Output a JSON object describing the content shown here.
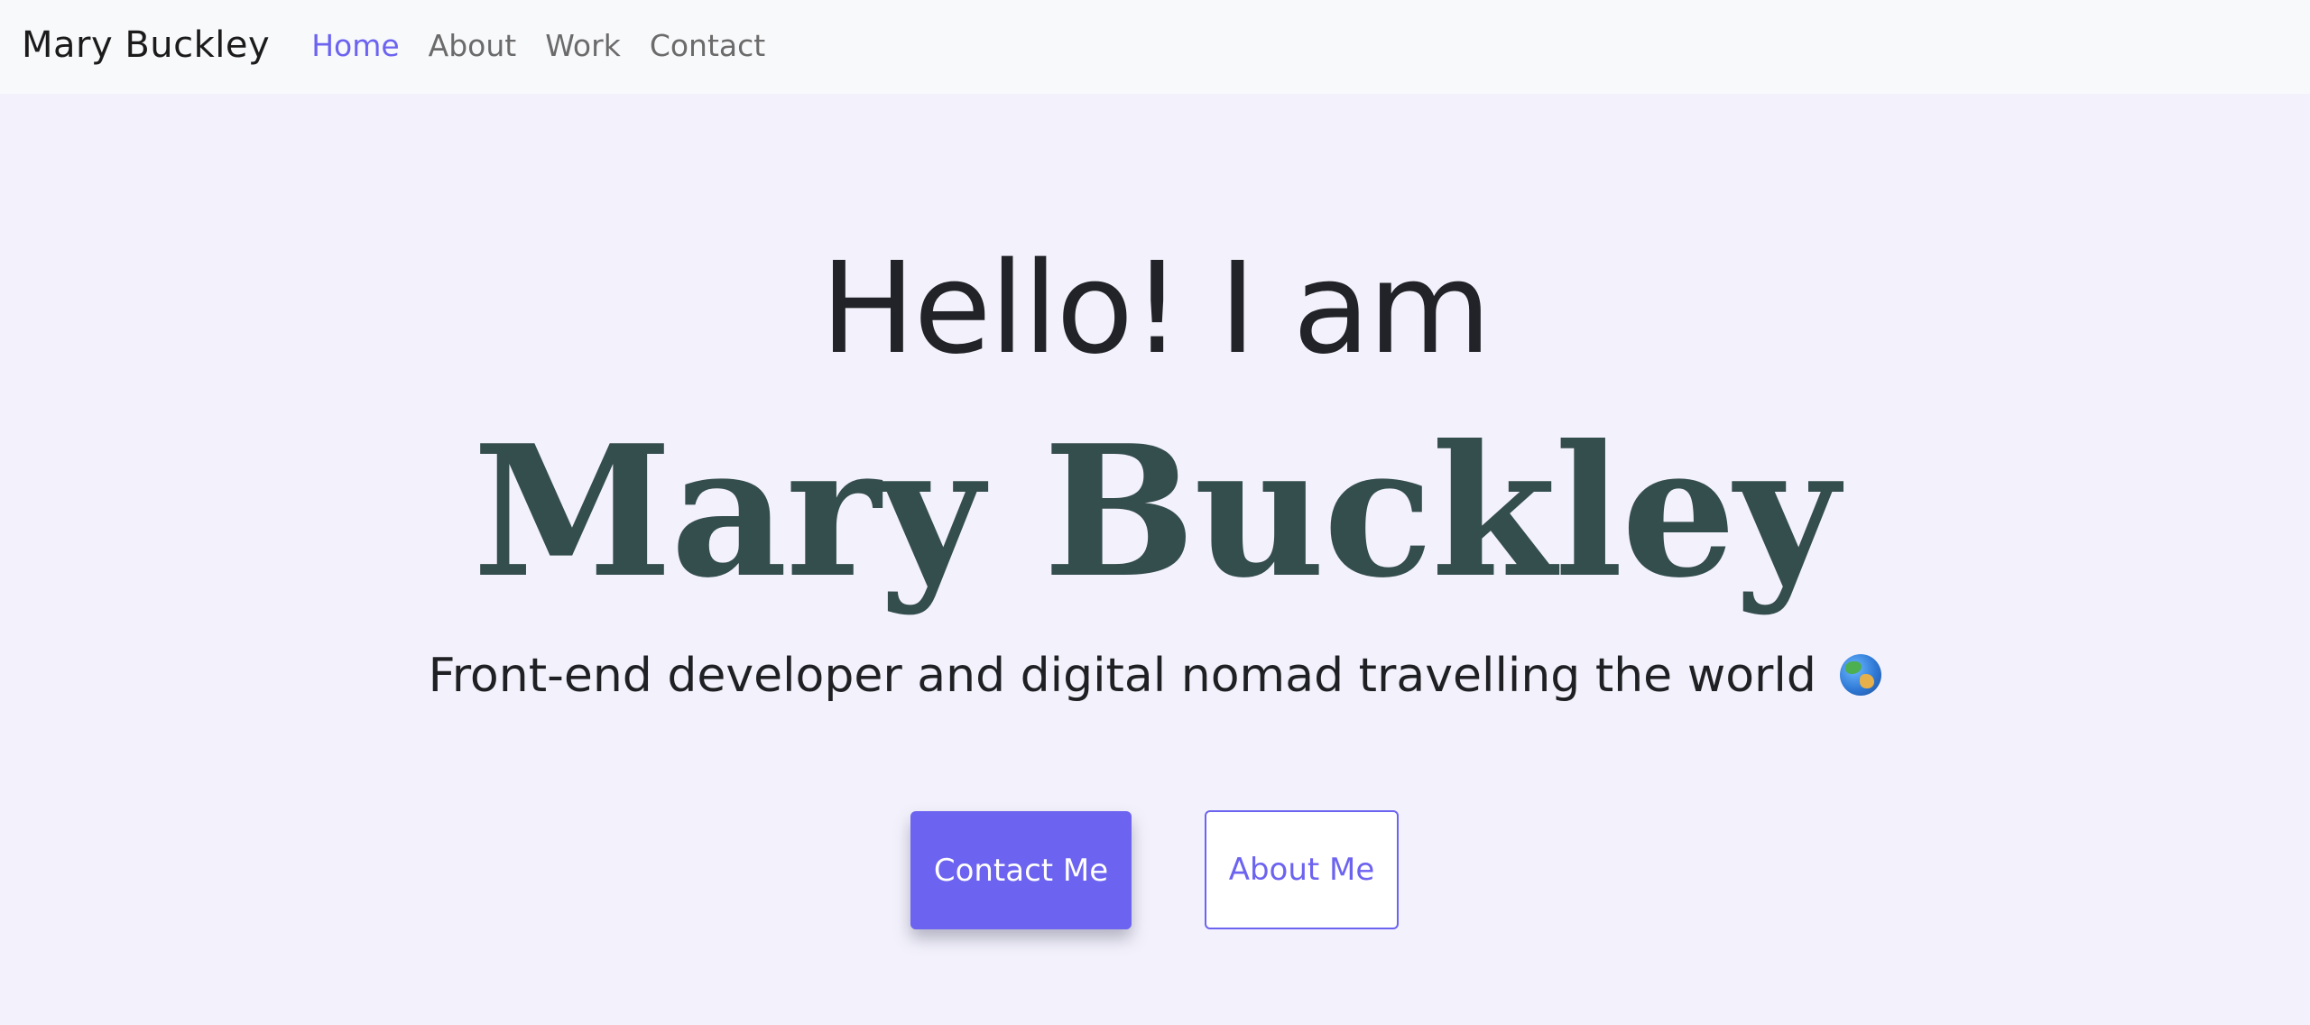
{
  "navbar": {
    "brand": "Mary Buckley",
    "links": [
      {
        "label": "Home",
        "active": true
      },
      {
        "label": "About",
        "active": false
      },
      {
        "label": "Work",
        "active": false
      },
      {
        "label": "Contact",
        "active": false
      }
    ]
  },
  "hero": {
    "greeting": "Hello! I am",
    "name": "Mary Buckley",
    "tagline": "Front-end developer and digital nomad travelling the world",
    "tagline_icon": "globe-icon"
  },
  "buttons": {
    "primary_label": "Contact Me",
    "secondary_label": "About Me"
  },
  "colors": {
    "accent": "#6c63f0",
    "name": "#344d4d",
    "background": "#f3f2fc",
    "navbar": "#f8f9fb"
  }
}
